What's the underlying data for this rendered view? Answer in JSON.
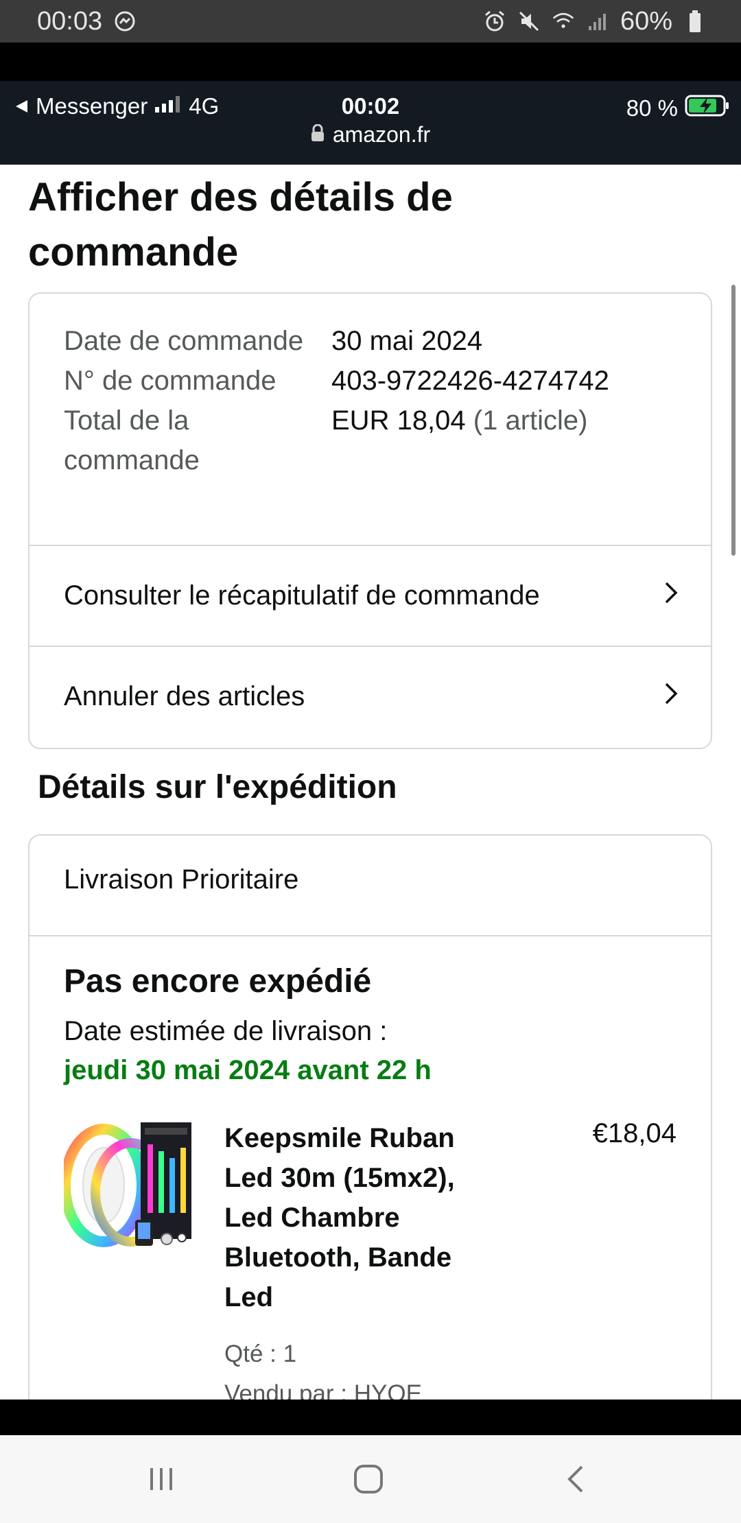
{
  "android_status": {
    "time": "00:03",
    "battery": "60%"
  },
  "ios_status": {
    "back_app": "Messenger",
    "network": "4G",
    "time": "00:02",
    "battery": "80 %",
    "url": "amazon.fr"
  },
  "page": {
    "title": "Afficher des détails de commande",
    "order_info": {
      "date_label": "Date de commande",
      "date_value": "30 mai 2024",
      "number_label": "N° de commande",
      "number_value": "403-9722426-4274742",
      "total_label": "Total de la commande",
      "total_value": "EUR 18,04",
      "total_items": "(1 article)"
    },
    "links": {
      "summary": "Consulter le récapitulatif de commande",
      "cancel": "Annuler des articles"
    },
    "shipping": {
      "section_title": "Détails sur l'expédition",
      "method": "Livraison Prioritaire",
      "status": "Pas encore expédié",
      "eta_label": "Date estimée de livraison :",
      "eta_date": "jeudi 30 mai 2024 avant 22 h"
    },
    "product": {
      "title": "Keepsmile Ruban Led 30m (15mx2), Led Chambre Bluetooth, Bande Led",
      "price": "€18,04",
      "qty": "Qté : 1",
      "seller": "Vendu par : HYOE"
    }
  },
  "colors": {
    "header_bg": "#131a22",
    "eta_green": "#067d12",
    "border": "#d5d9d9"
  }
}
